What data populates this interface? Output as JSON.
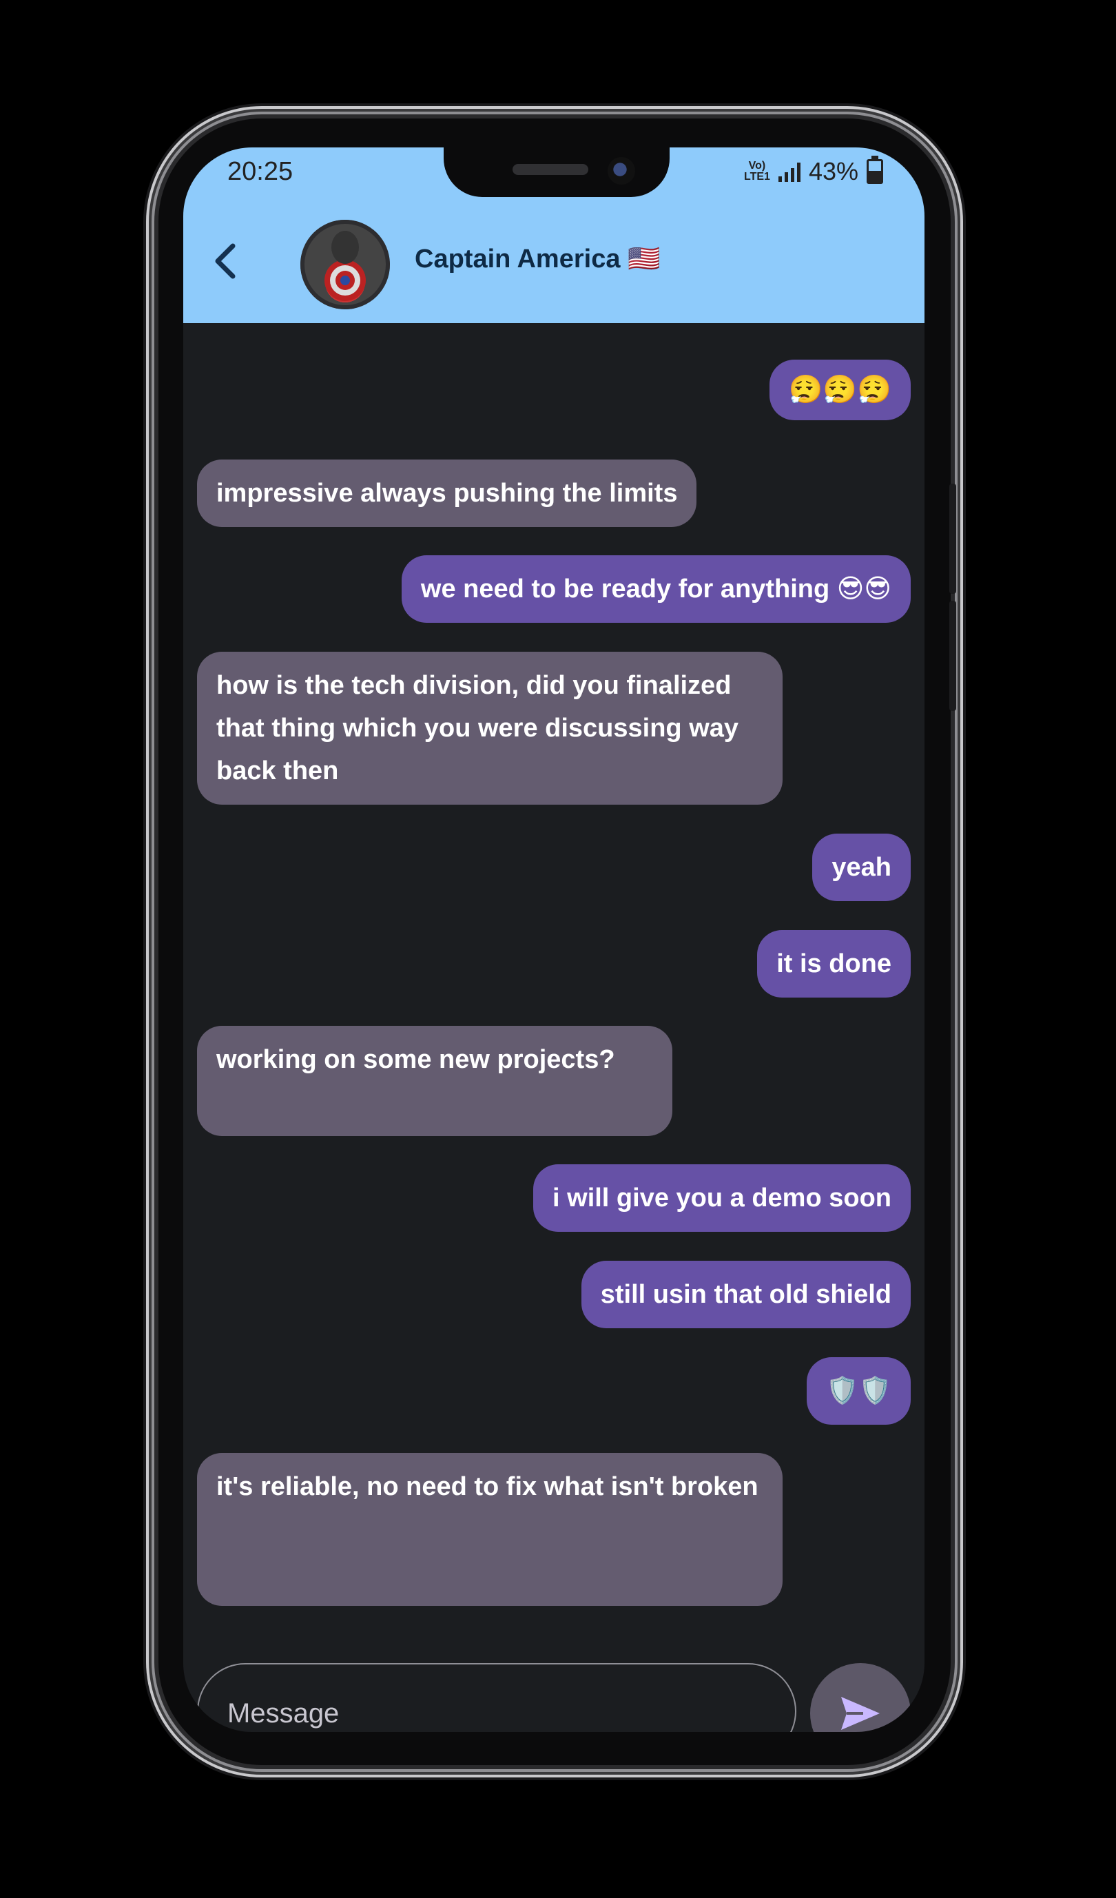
{
  "status_bar": {
    "time": "20:25",
    "network": "VoLTE LTE1",
    "battery": "43%"
  },
  "header": {
    "contact_name": "Captain America 🇺🇸"
  },
  "messages": [
    {
      "direction": "out",
      "text": "😮‍💨😮‍💨😮‍💨"
    },
    {
      "direction": "in",
      "text": "impressive always pushing the limits"
    },
    {
      "direction": "out",
      "text": "we need to be ready for anything 😎😎"
    },
    {
      "direction": "in",
      "text": "how is the tech division, did you finalized that thing which you were discussing way back then"
    },
    {
      "direction": "out",
      "text": "yeah"
    },
    {
      "direction": "out",
      "text": "it is done"
    },
    {
      "direction": "in",
      "text": "working on some new projects?"
    },
    {
      "direction": "out",
      "text": "i will give you a demo soon"
    },
    {
      "direction": "out",
      "text": "still usin that old shield"
    },
    {
      "direction": "out",
      "text": "🛡️🛡️"
    },
    {
      "direction": "in",
      "text": "it's reliable, no need to fix what isn't broken"
    }
  ],
  "composer": {
    "placeholder": "Message"
  },
  "colors": {
    "header_bg": "#8ecbfb",
    "chat_bg": "#1b1d20",
    "outgoing_bubble": "#6651a6",
    "incoming_bubble": "#645c70",
    "send_button": "#5d5868",
    "send_icon": "#c9b8ff"
  },
  "icons": {
    "back": "chevron-left-icon",
    "send": "send-icon",
    "recents": "recents-icon",
    "home": "home-icon",
    "nav_back": "nav-back-icon"
  }
}
